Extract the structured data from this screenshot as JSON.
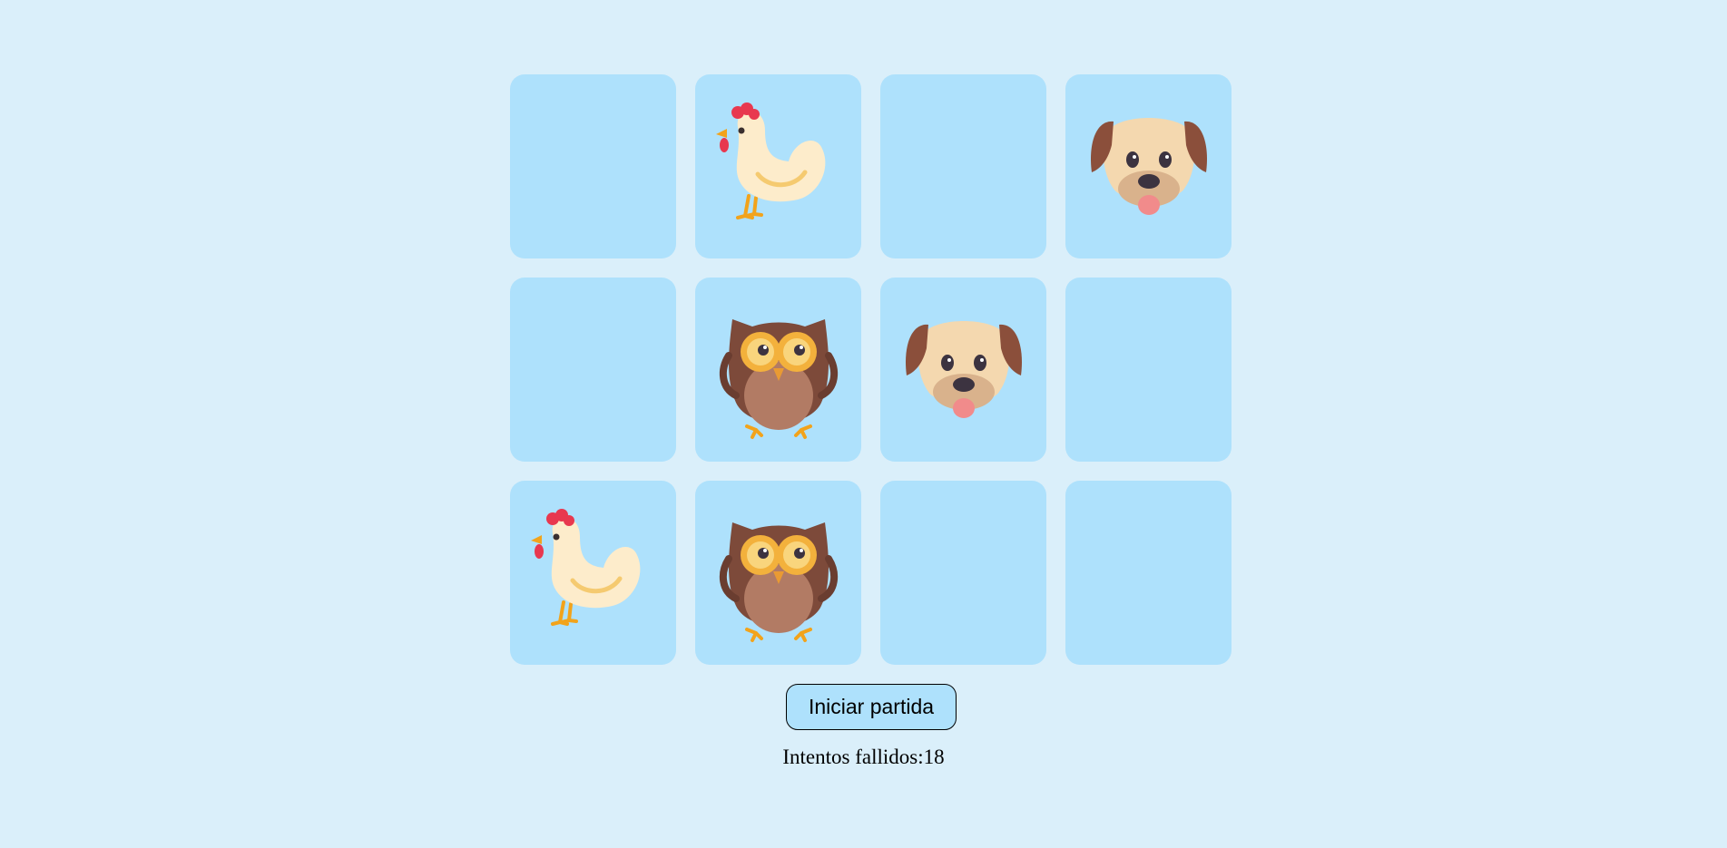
{
  "board": {
    "rows": 3,
    "columns": 4,
    "cards": [
      {
        "animal": "",
        "revealed": false
      },
      {
        "animal": "chicken",
        "revealed": true
      },
      {
        "animal": "",
        "revealed": false
      },
      {
        "animal": "dog",
        "revealed": true
      },
      {
        "animal": "",
        "revealed": false
      },
      {
        "animal": "owl",
        "revealed": true
      },
      {
        "animal": "dog",
        "revealed": true
      },
      {
        "animal": "",
        "revealed": false
      },
      {
        "animal": "chicken",
        "revealed": true
      },
      {
        "animal": "owl",
        "revealed": true
      },
      {
        "animal": "",
        "revealed": false
      },
      {
        "animal": "",
        "revealed": false
      }
    ]
  },
  "controls": {
    "start_label": "Iniciar partida"
  },
  "status": {
    "failed_label": "Intentos fallidos:",
    "failed_count": "18"
  },
  "colors": {
    "page_background": "#daeffa",
    "card_background": "#aee1fc"
  }
}
